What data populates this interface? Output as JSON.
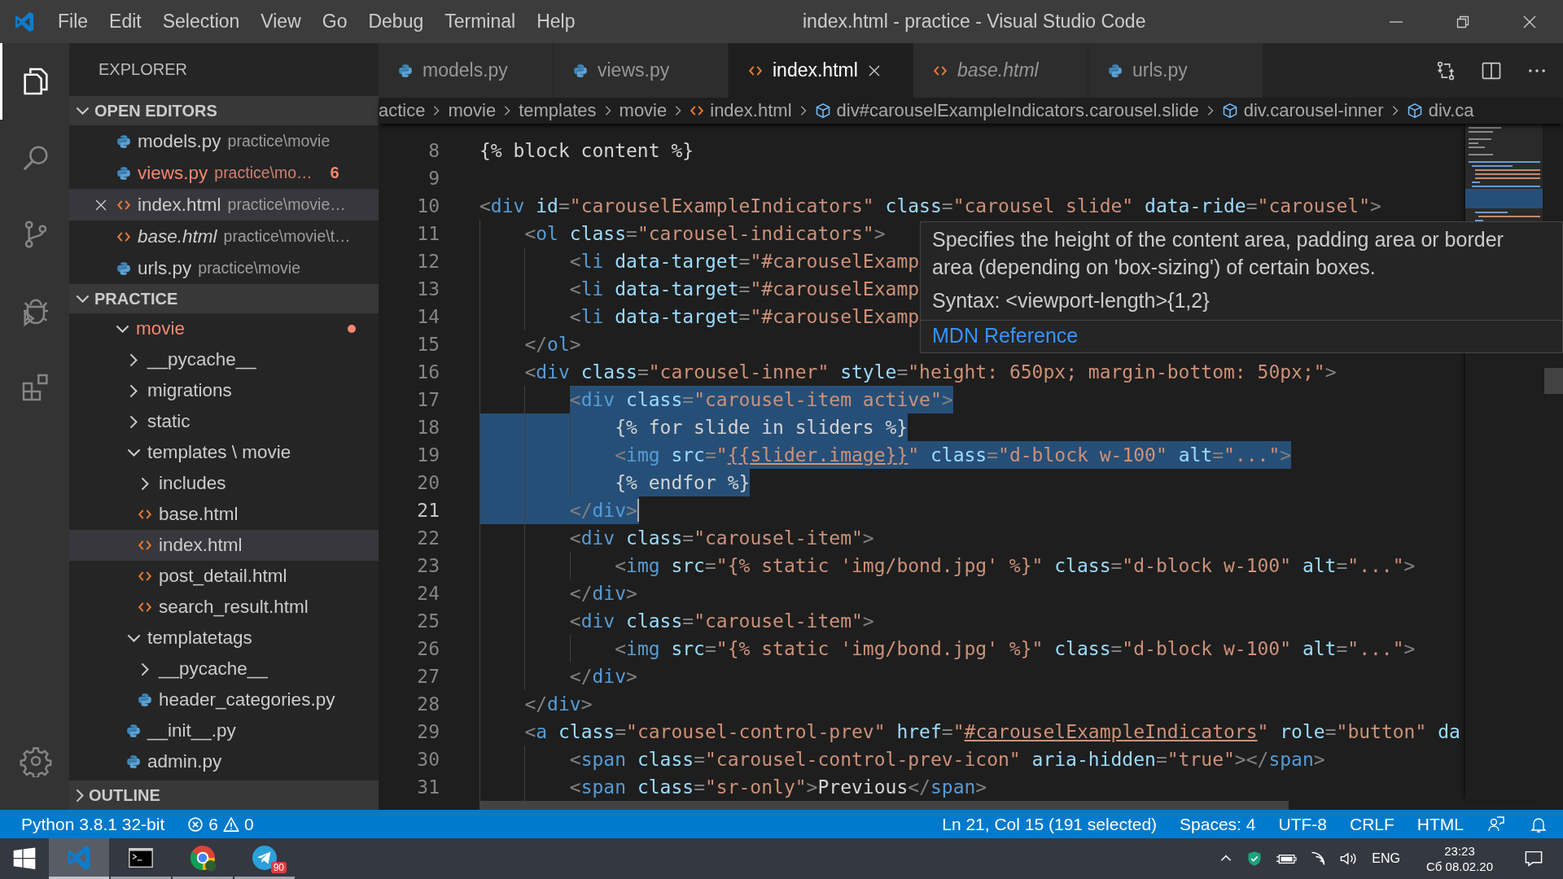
{
  "titlebar": {
    "menu": [
      "File",
      "Edit",
      "Selection",
      "View",
      "Go",
      "Debug",
      "Terminal",
      "Help"
    ],
    "title": "index.html - practice - Visual Studio Code"
  },
  "activity_bar": [
    {
      "kind": "explorer",
      "selected": true
    },
    {
      "kind": "search",
      "selected": false
    },
    {
      "kind": "scm",
      "selected": false
    },
    {
      "kind": "debug",
      "selected": false
    },
    {
      "kind": "extensions",
      "selected": false
    },
    {
      "kind": "settings",
      "selected": false
    }
  ],
  "sidebar": {
    "title": "EXPLORER",
    "open_editors": {
      "title": "OPEN EDITORS",
      "expanded": true,
      "items": [
        {
          "name": "models.py",
          "path": "practice\\movie",
          "kind": "py",
          "selected": false,
          "problem": false,
          "italic": false
        },
        {
          "name": "views.py",
          "path": "practice\\mo…",
          "kind": "py",
          "selected": false,
          "problem": true,
          "italic": false,
          "count": "6"
        },
        {
          "name": "index.html",
          "path": "practice\\movie…",
          "kind": "html",
          "selected": true,
          "problem": false,
          "italic": false
        },
        {
          "name": "base.html",
          "path": "practice\\movie\\t…",
          "kind": "html",
          "selected": false,
          "problem": false,
          "italic": true
        },
        {
          "name": "urls.py",
          "path": "practice\\movie",
          "kind": "py",
          "selected": false,
          "problem": false,
          "italic": false
        }
      ]
    },
    "practice": {
      "title": "PRACTICE",
      "expanded": true,
      "tree": [
        {
          "label": "movie",
          "kind": "folder",
          "expanded": true,
          "selected": false,
          "problem": true,
          "children": [
            {
              "label": "__pycache__",
              "kind": "folder",
              "expanded": false,
              "selected": false,
              "problem": false
            },
            {
              "label": "migrations",
              "kind": "folder",
              "expanded": false,
              "selected": false,
              "problem": false
            },
            {
              "label": "static",
              "kind": "folder",
              "expanded": false,
              "selected": false,
              "problem": false
            },
            {
              "label": "templates \\ movie",
              "kind": "folder",
              "expanded": true,
              "selected": false,
              "problem": false,
              "children": [
                {
                  "label": "includes",
                  "kind": "folder",
                  "expanded": false,
                  "selected": false,
                  "problem": false
                },
                {
                  "label": "base.html",
                  "kind": "html",
                  "selected": false,
                  "problem": false
                },
                {
                  "label": "index.html",
                  "kind": "html",
                  "selected": true,
                  "problem": false
                },
                {
                  "label": "post_detail.html",
                  "kind": "html",
                  "selected": false,
                  "problem": false
                },
                {
                  "label": "search_result.html",
                  "kind": "html",
                  "selected": false,
                  "problem": false
                }
              ]
            },
            {
              "label": "templatetags",
              "kind": "folder",
              "expanded": true,
              "selected": false,
              "problem": false,
              "children": [
                {
                  "label": "__pycache__",
                  "kind": "folder",
                  "expanded": false,
                  "selected": false,
                  "problem": false
                },
                {
                  "label": "header_categories.py",
                  "kind": "py",
                  "selected": false,
                  "problem": false
                }
              ]
            },
            {
              "label": "__init__.py",
              "kind": "py",
              "selected": false,
              "problem": false
            },
            {
              "label": "admin.py",
              "kind": "py",
              "selected": false,
              "problem": false
            }
          ]
        }
      ]
    },
    "outline": {
      "title": "OUTLINE",
      "expanded": false
    }
  },
  "tabs": [
    {
      "label": "models.py",
      "kind": "py",
      "selected": false,
      "italic": false
    },
    {
      "label": "views.py",
      "kind": "py",
      "selected": false,
      "italic": false
    },
    {
      "label": "index.html",
      "kind": "html",
      "selected": true,
      "italic": false
    },
    {
      "label": "base.html",
      "kind": "html",
      "selected": false,
      "italic": true
    },
    {
      "label": "urls.py",
      "kind": "py",
      "selected": false,
      "italic": false
    }
  ],
  "breadcrumbs": [
    {
      "label": "actice"
    },
    {
      "label": "movie"
    },
    {
      "label": "templates"
    },
    {
      "label": "movie"
    },
    {
      "label": "index.html",
      "kind": "html"
    },
    {
      "label": "div#carouselExampleIndicators.carousel.slide",
      "kind": "symbol"
    },
    {
      "label": "div.carousel-inner",
      "kind": "symbol"
    },
    {
      "label": "div.ca",
      "kind": "symbol"
    }
  ],
  "editor": {
    "lines": [
      {
        "n": "8",
        "in_selection": false,
        "cursor": false,
        "tokens": [
          {
            "kind": "text",
            "text": "{% block content %}"
          }
        ]
      },
      {
        "n": "9",
        "cursor": false
      },
      {
        "n": "10",
        "in_selection": false,
        "cursor": false,
        "tokens": [
          {
            "kind": "punct",
            "text": "<"
          },
          {
            "kind": "tag",
            "text": "div"
          },
          {
            "kind": "attr",
            "text": " id"
          },
          {
            "kind": "punct",
            "text": "="
          },
          {
            "kind": "string",
            "text": "\"carouselExampleIndicators\""
          },
          {
            "kind": "attr",
            "text": " class"
          },
          {
            "kind": "punct",
            "text": "="
          },
          {
            "kind": "string",
            "text": "\"carousel slide\""
          },
          {
            "kind": "attr",
            "text": " data-ride"
          },
          {
            "kind": "punct",
            "text": "="
          },
          {
            "kind": "string",
            "text": "\"carousel\""
          },
          {
            "kind": "punct",
            "text": ">"
          }
        ]
      },
      {
        "n": "11",
        "in_selection": false,
        "cursor": false,
        "tokens": [
          {
            "kind": "punct",
            "text": "    <"
          },
          {
            "kind": "tag",
            "text": "ol"
          },
          {
            "kind": "attr",
            "text": " class"
          },
          {
            "kind": "punct",
            "text": "="
          },
          {
            "kind": "string",
            "text": "\"carousel-indicators\""
          },
          {
            "kind": "punct",
            "text": ">"
          }
        ]
      },
      {
        "n": "12",
        "in_selection": false,
        "cursor": false,
        "tokens": [
          {
            "kind": "punct",
            "text": "        <"
          },
          {
            "kind": "tag",
            "text": "li"
          },
          {
            "kind": "attr",
            "text": " data-target"
          },
          {
            "kind": "punct",
            "text": "="
          },
          {
            "kind": "string",
            "text": "\"#carouselExamp"
          }
        ]
      },
      {
        "n": "13",
        "in_selection": false,
        "cursor": false,
        "tokens": [
          {
            "kind": "punct",
            "text": "        <"
          },
          {
            "kind": "tag",
            "text": "li"
          },
          {
            "kind": "attr",
            "text": " data-target"
          },
          {
            "kind": "punct",
            "text": "="
          },
          {
            "kind": "string",
            "text": "\"#carouselExamp"
          }
        ]
      },
      {
        "n": "14",
        "in_selection": false,
        "cursor": false,
        "tokens": [
          {
            "kind": "punct",
            "text": "        <"
          },
          {
            "kind": "tag",
            "text": "li"
          },
          {
            "kind": "attr",
            "text": " data-target"
          },
          {
            "kind": "punct",
            "text": "="
          },
          {
            "kind": "string",
            "text": "\"#carouselExamp"
          }
        ]
      },
      {
        "n": "15",
        "in_selection": false,
        "cursor": false,
        "tokens": [
          {
            "kind": "punct",
            "text": "    </"
          },
          {
            "kind": "tag",
            "text": "ol"
          },
          {
            "kind": "punct",
            "text": ">"
          }
        ]
      },
      {
        "n": "16",
        "in_selection": false,
        "cursor": false,
        "tokens": [
          {
            "kind": "punct",
            "text": "    <"
          },
          {
            "kind": "tag",
            "text": "div"
          },
          {
            "kind": "attr",
            "text": " class"
          },
          {
            "kind": "punct",
            "text": "="
          },
          {
            "kind": "string",
            "text": "\"carousel-inner\""
          },
          {
            "kind": "attr",
            "text": " style"
          },
          {
            "kind": "punct",
            "text": "="
          },
          {
            "kind": "string",
            "text": "\"height: 650px; margin-bottom: 50px;\""
          },
          {
            "kind": "punct",
            "text": ">"
          }
        ]
      },
      {
        "n": "17",
        "in_selection": true,
        "cursor": false,
        "tokens": [
          {
            "kind": "punct",
            "text": "        <"
          },
          {
            "kind": "tag",
            "text": "div"
          },
          {
            "kind": "attr",
            "text": " class"
          },
          {
            "kind": "punct",
            "text": "="
          },
          {
            "kind": "string",
            "text": "\"carousel-item active\""
          },
          {
            "kind": "punct",
            "text": ">"
          }
        ]
      },
      {
        "n": "18",
        "in_selection": true,
        "cursor": false,
        "tokens": [
          {
            "kind": "text",
            "text": "            {% for slide in sliders %}"
          }
        ]
      },
      {
        "n": "19",
        "in_selection": true,
        "cursor": false,
        "tokens": [
          {
            "kind": "punct",
            "text": "            <"
          },
          {
            "kind": "tag",
            "text": "img"
          },
          {
            "kind": "attr",
            "text": " src"
          },
          {
            "kind": "punct",
            "text": "="
          },
          {
            "kind": "string",
            "text": "\""
          },
          {
            "kind": "link",
            "text": "{{slider.image}}"
          },
          {
            "kind": "string",
            "text": "\""
          },
          {
            "kind": "attr",
            "text": " class"
          },
          {
            "kind": "punct",
            "text": "="
          },
          {
            "kind": "string",
            "text": "\"d-block w-100\""
          },
          {
            "kind": "attr",
            "text": " alt"
          },
          {
            "kind": "punct",
            "text": "="
          },
          {
            "kind": "string",
            "text": "\"...\""
          },
          {
            "kind": "punct",
            "text": ">"
          }
        ]
      },
      {
        "n": "20",
        "in_selection": true,
        "cursor": false,
        "tokens": [
          {
            "kind": "text",
            "text": "            {% endfor %}"
          }
        ]
      },
      {
        "n": "21",
        "in_selection": true,
        "cursor": true,
        "tokens": [
          {
            "kind": "punct",
            "text": "        </"
          },
          {
            "kind": "tag",
            "text": "div"
          },
          {
            "kind": "punct",
            "text": ">"
          }
        ]
      },
      {
        "n": "22",
        "in_selection": false,
        "cursor": false,
        "tokens": [
          {
            "kind": "punct",
            "text": "        <"
          },
          {
            "kind": "tag",
            "text": "div"
          },
          {
            "kind": "attr",
            "text": " class"
          },
          {
            "kind": "punct",
            "text": "="
          },
          {
            "kind": "string",
            "text": "\"carousel-item\""
          },
          {
            "kind": "punct",
            "text": ">"
          }
        ]
      },
      {
        "n": "23",
        "in_selection": false,
        "cursor": false,
        "tokens": [
          {
            "kind": "punct",
            "text": "            <"
          },
          {
            "kind": "tag",
            "text": "img"
          },
          {
            "kind": "attr",
            "text": " src"
          },
          {
            "kind": "punct",
            "text": "="
          },
          {
            "kind": "string",
            "text": "\"{% static 'img/bond.jpg' %}\""
          },
          {
            "kind": "attr",
            "text": " class"
          },
          {
            "kind": "punct",
            "text": "="
          },
          {
            "kind": "string",
            "text": "\"d-block w-100\""
          },
          {
            "kind": "attr",
            "text": " alt"
          },
          {
            "kind": "punct",
            "text": "="
          },
          {
            "kind": "string",
            "text": "\"...\""
          },
          {
            "kind": "punct",
            "text": ">"
          }
        ]
      },
      {
        "n": "24",
        "in_selection": false,
        "cursor": false,
        "tokens": [
          {
            "kind": "punct",
            "text": "        </"
          },
          {
            "kind": "tag",
            "text": "div"
          },
          {
            "kind": "punct",
            "text": ">"
          }
        ]
      },
      {
        "n": "25",
        "in_selection": false,
        "cursor": false,
        "tokens": [
          {
            "kind": "punct",
            "text": "        <"
          },
          {
            "kind": "tag",
            "text": "div"
          },
          {
            "kind": "attr",
            "text": " class"
          },
          {
            "kind": "punct",
            "text": "="
          },
          {
            "kind": "string",
            "text": "\"carousel-item\""
          },
          {
            "kind": "punct",
            "text": ">"
          }
        ]
      },
      {
        "n": "26",
        "in_selection": false,
        "cursor": false,
        "tokens": [
          {
            "kind": "punct",
            "text": "            <"
          },
          {
            "kind": "tag",
            "text": "img"
          },
          {
            "kind": "attr",
            "text": " src"
          },
          {
            "kind": "punct",
            "text": "="
          },
          {
            "kind": "string",
            "text": "\"{% static 'img/bond.jpg' %}\""
          },
          {
            "kind": "attr",
            "text": " class"
          },
          {
            "kind": "punct",
            "text": "="
          },
          {
            "kind": "string",
            "text": "\"d-block w-100\""
          },
          {
            "kind": "attr",
            "text": " alt"
          },
          {
            "kind": "punct",
            "text": "="
          },
          {
            "kind": "string",
            "text": "\"...\""
          },
          {
            "kind": "punct",
            "text": ">"
          }
        ]
      },
      {
        "n": "27",
        "in_selection": false,
        "cursor": false,
        "tokens": [
          {
            "kind": "punct",
            "text": "        </"
          },
          {
            "kind": "tag",
            "text": "div"
          },
          {
            "kind": "punct",
            "text": ">"
          }
        ]
      },
      {
        "n": "28",
        "in_selection": false,
        "cursor": false,
        "tokens": [
          {
            "kind": "punct",
            "text": "    </"
          },
          {
            "kind": "tag",
            "text": "div"
          },
          {
            "kind": "punct",
            "text": ">"
          }
        ]
      },
      {
        "n": "29",
        "in_selection": false,
        "cursor": false,
        "tokens": [
          {
            "kind": "punct",
            "text": "    <"
          },
          {
            "kind": "tag",
            "text": "a"
          },
          {
            "kind": "attr",
            "text": " class"
          },
          {
            "kind": "punct",
            "text": "="
          },
          {
            "kind": "string",
            "text": "\"carousel-control-prev\""
          },
          {
            "kind": "attr",
            "text": " href"
          },
          {
            "kind": "punct",
            "text": "="
          },
          {
            "kind": "string",
            "text": "\""
          },
          {
            "kind": "link",
            "text": "#carouselExampleIndicators"
          },
          {
            "kind": "string",
            "text": "\""
          },
          {
            "kind": "attr",
            "text": " role"
          },
          {
            "kind": "punct",
            "text": "="
          },
          {
            "kind": "string",
            "text": "\"button\""
          },
          {
            "kind": "attr",
            "text": " da"
          }
        ]
      },
      {
        "n": "30",
        "in_selection": false,
        "cursor": false,
        "tokens": [
          {
            "kind": "punct",
            "text": "        <"
          },
          {
            "kind": "tag",
            "text": "span"
          },
          {
            "kind": "attr",
            "text": " class"
          },
          {
            "kind": "punct",
            "text": "="
          },
          {
            "kind": "string",
            "text": "\"carousel-control-prev-icon\""
          },
          {
            "kind": "attr",
            "text": " aria-hidden"
          },
          {
            "kind": "punct",
            "text": "="
          },
          {
            "kind": "string",
            "text": "\"true\""
          },
          {
            "kind": "punct",
            "text": "></"
          },
          {
            "kind": "tag",
            "text": "span"
          },
          {
            "kind": "punct",
            "text": ">"
          }
        ]
      },
      {
        "n": "31",
        "in_selection": false,
        "cursor": false,
        "tokens": [
          {
            "kind": "punct",
            "text": "        <"
          },
          {
            "kind": "tag",
            "text": "span"
          },
          {
            "kind": "attr",
            "text": " class"
          },
          {
            "kind": "punct",
            "text": "="
          },
          {
            "kind": "string",
            "text": "\"sr-only\""
          },
          {
            "kind": "punct",
            "text": ">"
          },
          {
            "kind": "text",
            "text": "Previous"
          },
          {
            "kind": "punct",
            "text": "</"
          },
          {
            "kind": "tag",
            "text": "span"
          },
          {
            "kind": "punct",
            "text": ">"
          }
        ]
      }
    ]
  },
  "hover": {
    "description": "Specifies the height of the content area, padding area or border area (depending on 'box-sizing') of certain boxes.",
    "syntax": "Syntax: <viewport-length>{1,2}",
    "link": "MDN Reference"
  },
  "status_bar": {
    "interpreter": "Python 3.8.1 32-bit",
    "errors": "6",
    "warnings": "0",
    "position": "Ln 21, Col 15 (191 selected)",
    "indentation": "Spaces: 4",
    "encoding": "UTF-8",
    "eol": "CRLF",
    "language": "HTML"
  },
  "taskbar": {
    "apps": [
      {
        "kind": "vscode",
        "selected": true
      },
      {
        "kind": "terminal",
        "selected": false
      },
      {
        "kind": "chrome",
        "selected": false
      },
      {
        "kind": "telegram",
        "selected": false,
        "badge": "90"
      }
    ],
    "language": "ENG",
    "time": "23:23",
    "date": "Сб 08.02.20"
  }
}
